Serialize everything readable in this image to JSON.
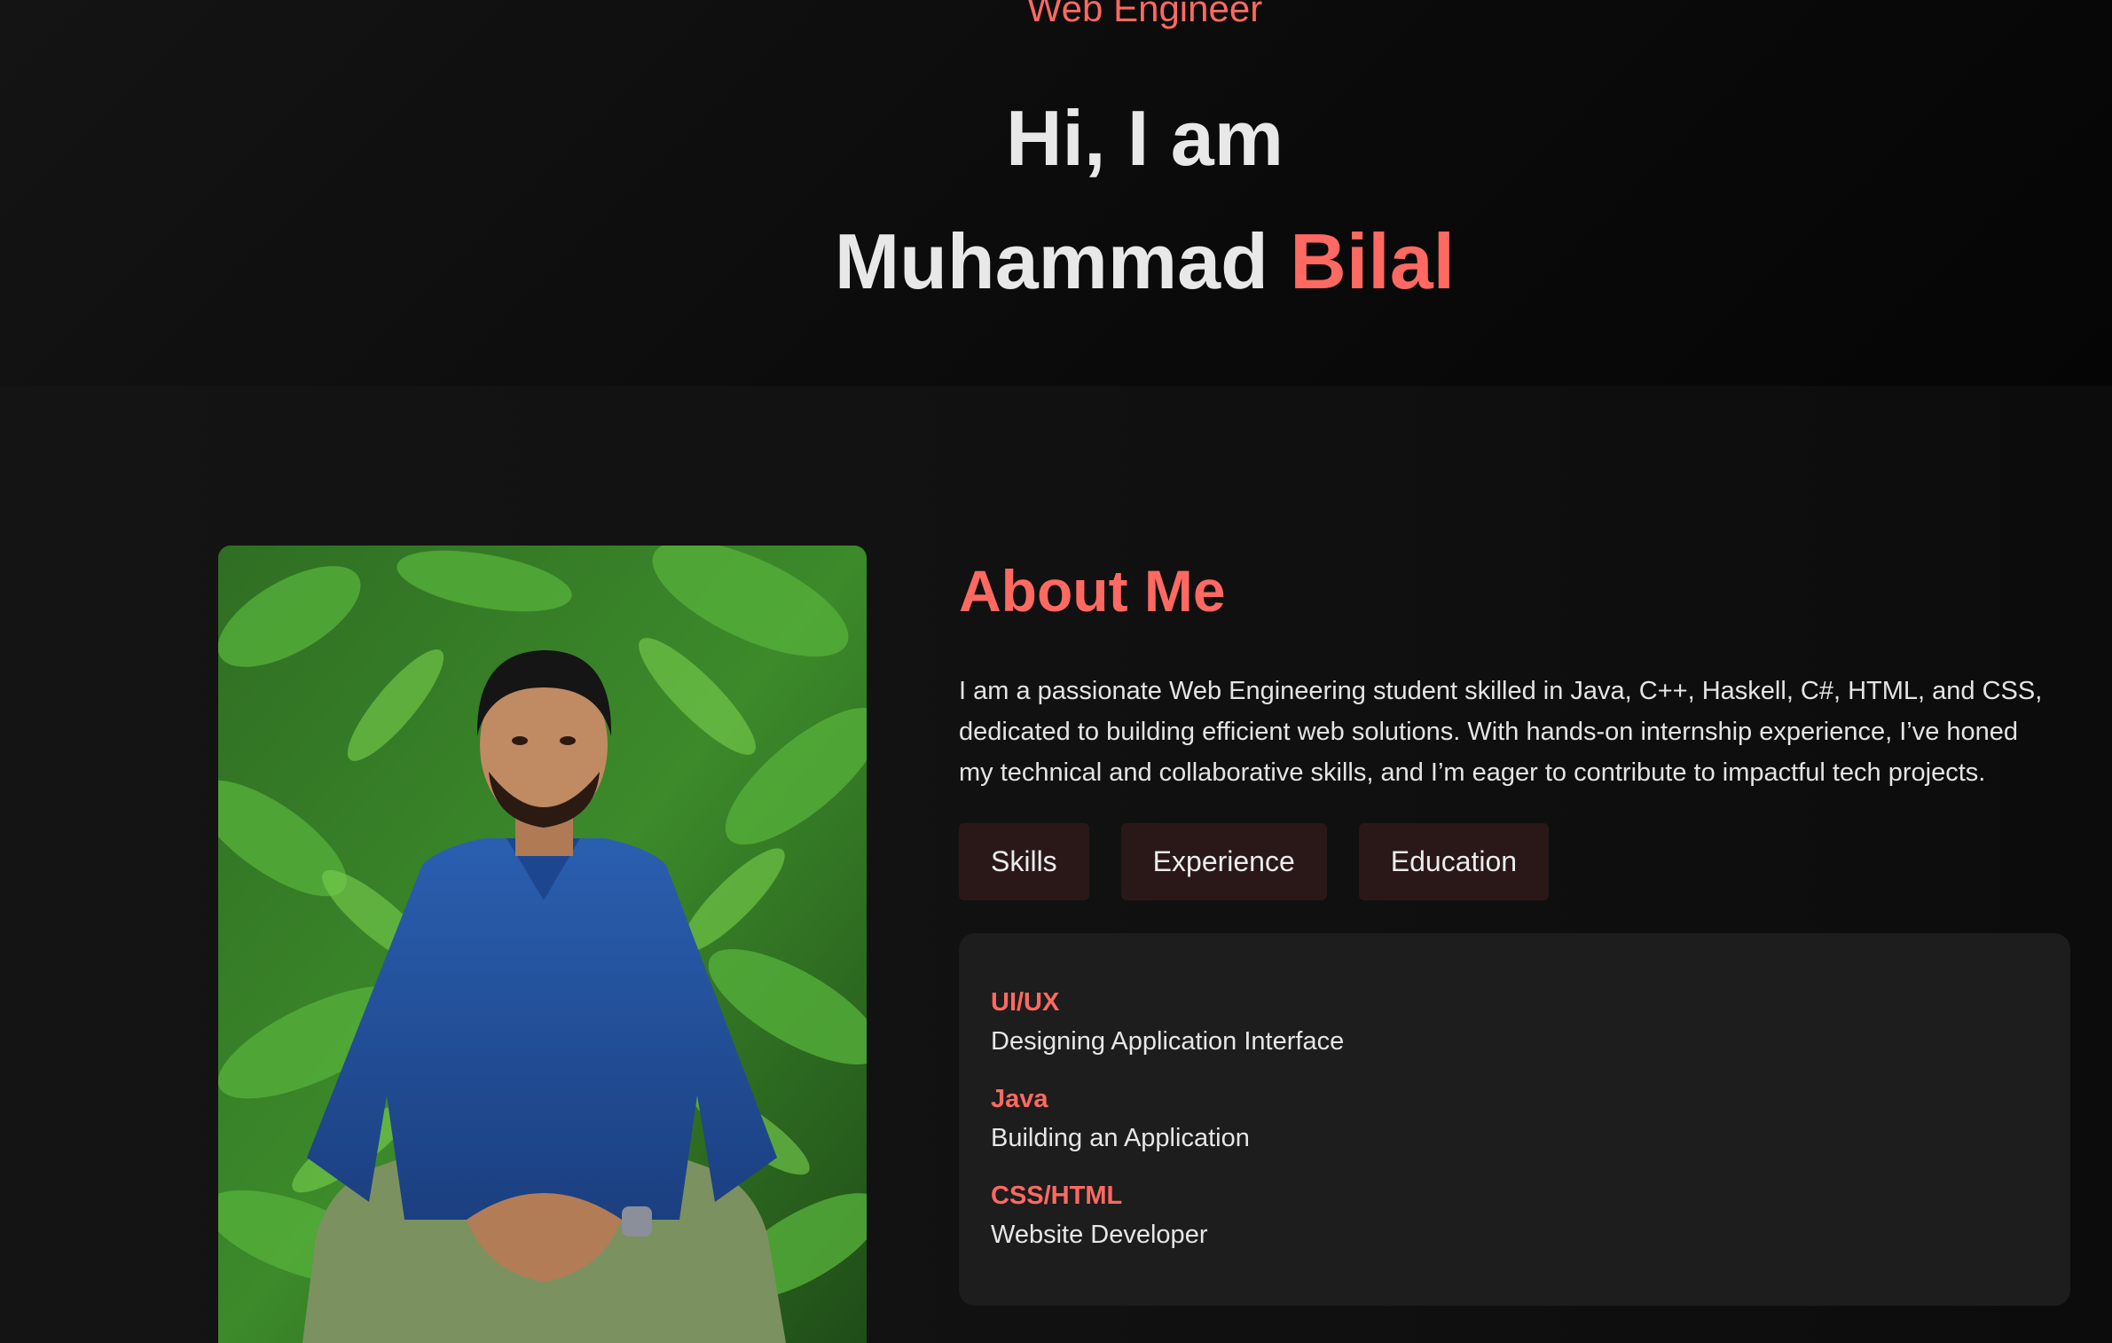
{
  "hero": {
    "role": "Web Engineer",
    "greeting": "Hi, I am",
    "first_name": "Muhammad",
    "last_name": "Bilal"
  },
  "about": {
    "title": "About Me",
    "text": "I am a passionate Web Engineering student skilled in Java, C++, Haskell, C#, HTML, and CSS, dedicated to building efficient web solutions. With hands-on internship experience, I’ve honed my technical and collaborative skills, and I’m eager to contribute to impactful tech projects.",
    "tabs": [
      {
        "label": "Skills"
      },
      {
        "label": "Experience"
      },
      {
        "label": "Education"
      }
    ],
    "skills": [
      {
        "name": "UI/UX",
        "desc": "Designing Application Interface"
      },
      {
        "name": "Java",
        "desc": "Building an Application"
      },
      {
        "name": "CSS/HTML",
        "desc": "Website Developer"
      }
    ]
  },
  "photo": {
    "icon": "profile-photo"
  },
  "colors": {
    "accent": "#ff6961",
    "background": "#111111",
    "panel": "#1d1d1d",
    "tab": "#2a1818"
  }
}
